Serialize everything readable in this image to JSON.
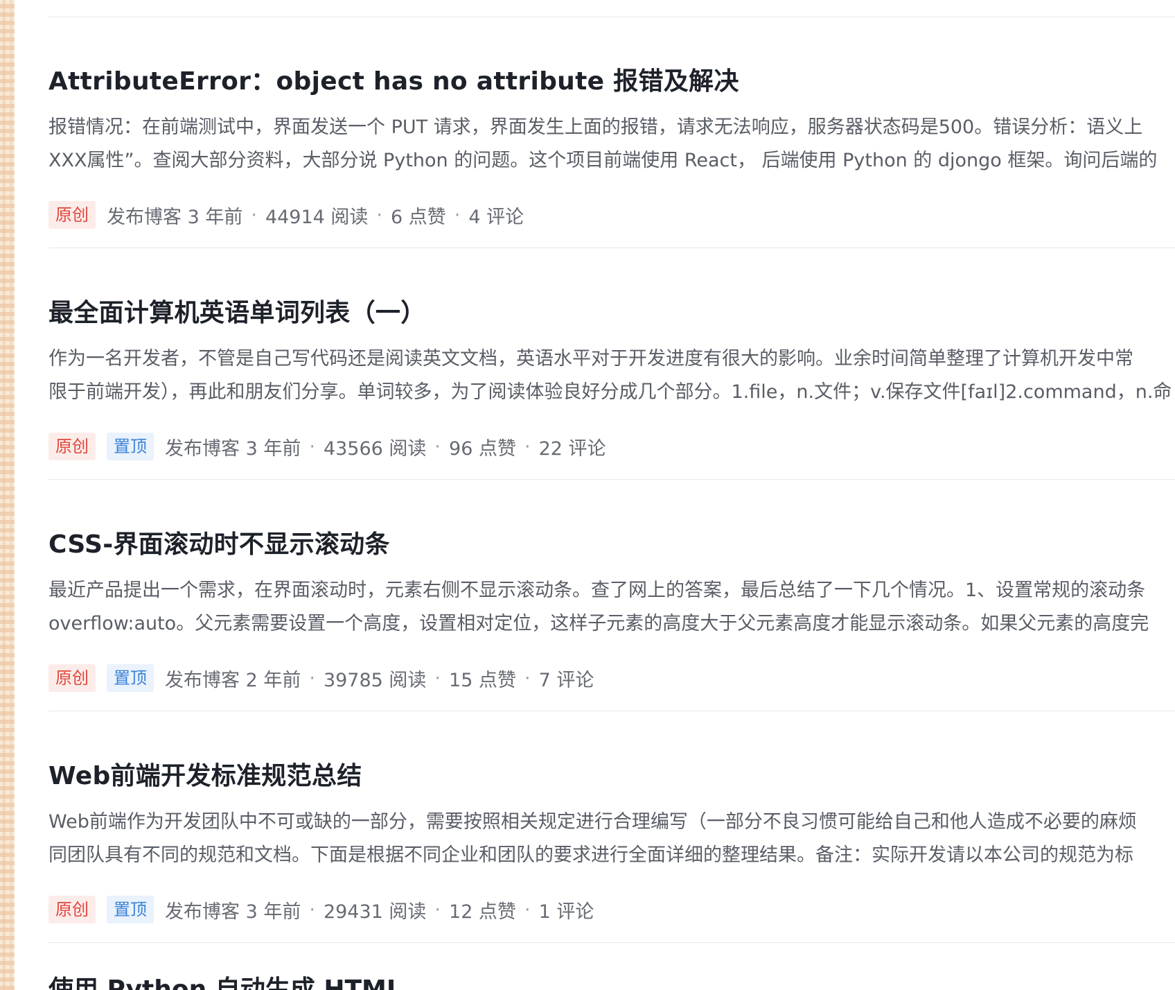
{
  "articles": [
    {
      "title": "AttributeError：object has no attribute 报错及解决",
      "summary_line1": "报错情况：在前端测试中，界面发送一个 PUT 请求，界面发生上面的报错，请求无法响应，服务器状态码是500。错误分析：语义上",
      "summary_line2": "XXX属性”。查阅大部分资料，大部分说 Python 的问题。这个项目前端使用 React， 后端使用 Python 的 djongo 框架。询问后端的",
      "tag_original": "原创",
      "tag_pinned": "",
      "published": "发布博客 3 年前",
      "reads": "44914 阅读",
      "likes": "6 点赞",
      "comments": "4 评论"
    },
    {
      "title": "最全面计算机英语单词列表（一）",
      "summary_line1": "作为一名开发者，不管是自己写代码还是阅读英文文档，英语水平对于开发进度有很大的影响。业余时间简单整理了计算机开发中常",
      "summary_line2": "限于前端开发），再此和朋友们分享。单词较多，为了阅读体验良好分成几个部分。1.file，n.文件；v.保存文件[faɪl]2.command，n.命",
      "tag_original": "原创",
      "tag_pinned": "置顶",
      "published": "发布博客 3 年前",
      "reads": "43566 阅读",
      "likes": "96 点赞",
      "comments": "22 评论"
    },
    {
      "title": "CSS-界面滚动时不显示滚动条",
      "summary_line1": "最近产品提出一个需求，在界面滚动时，元素右侧不显示滚动条。查了网上的答案，最后总结了一下几个情况。1、设置常规的滚动条",
      "summary_line2": "overflow:auto。父元素需要设置一个高度，设置相对定位，这样子元素的高度大于父元素高度才能显示滚动条。如果父元素的高度完",
      "tag_original": "原创",
      "tag_pinned": "置顶",
      "published": "发布博客 2 年前",
      "reads": "39785 阅读",
      "likes": "15 点赞",
      "comments": "7 评论"
    },
    {
      "title": "Web前端开发标准规范总结",
      "summary_line1": "Web前端作为开发团队中不可或缺的一部分，需要按照相关规定进行合理编写（一部分不良习惯可能给自己和他人造成不必要的麻烦",
      "summary_line2": "同团队具有不同的规范和文档。下面是根据不同企业和团队的要求进行全面详细的整理结果。备注：实际开发请以本公司的规范为标",
      "tag_original": "原创",
      "tag_pinned": "置顶",
      "published": "发布博客 3 年前",
      "reads": "29431 阅读",
      "likes": "12 点赞",
      "comments": "1 评论"
    }
  ],
  "next_article_title": "使用 Python 自动生成 HTML",
  "separator": "·"
}
